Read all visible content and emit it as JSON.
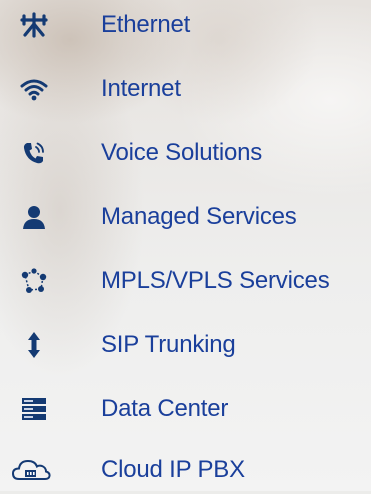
{
  "menu": {
    "items": [
      {
        "label": "Ethernet",
        "icon": "ethernet-icon"
      },
      {
        "label": "Internet",
        "icon": "wifi-icon"
      },
      {
        "label": "Voice Solutions",
        "icon": "phone-icon"
      },
      {
        "label": "Managed Services",
        "icon": "user-icon"
      },
      {
        "label": "MPLS/VPLS Services",
        "icon": "network-icon"
      },
      {
        "label": "SIP Trunking",
        "icon": "updown-arrow-icon"
      },
      {
        "label": "Data Center",
        "icon": "server-icon"
      },
      {
        "label": "Cloud IP PBX",
        "icon": "cloud-pbx-icon"
      }
    ]
  },
  "colors": {
    "label": "#1a3f9b",
    "icon": "#143a73"
  }
}
